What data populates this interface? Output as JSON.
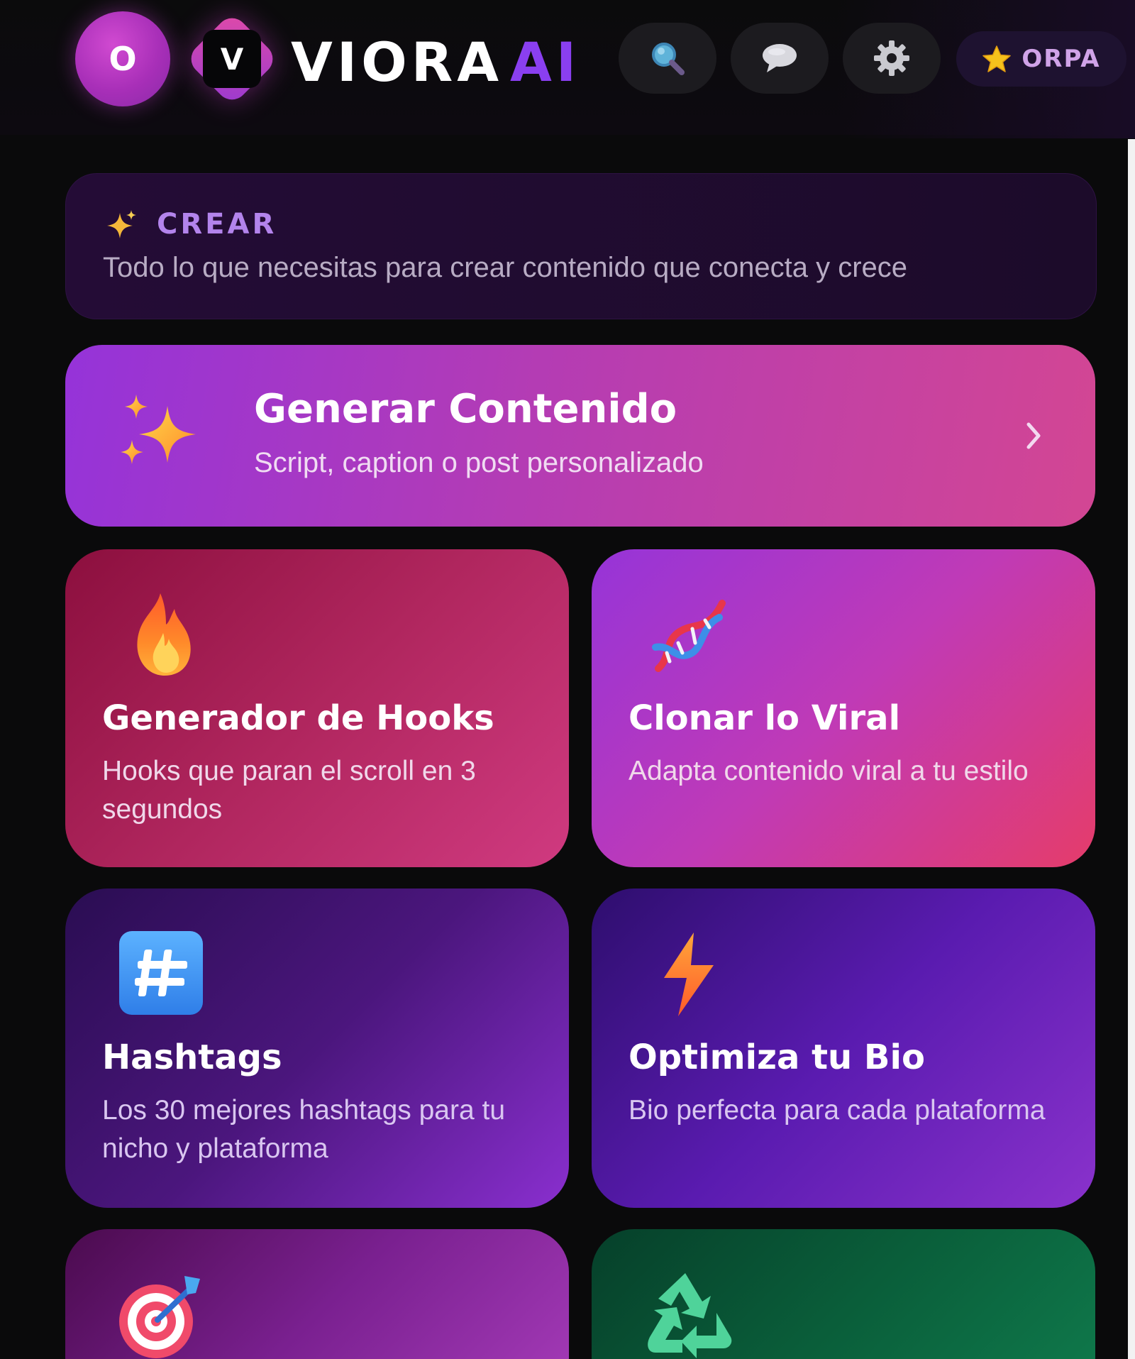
{
  "header": {
    "avatar_initial": "O",
    "logo_letter": "V",
    "brand_primary": "VIORA",
    "brand_accent": "AI",
    "actions": [
      {
        "icon": "search-icon"
      },
      {
        "icon": "chat-bubble-icon"
      },
      {
        "icon": "gear-icon"
      }
    ],
    "pro_badge": {
      "icon": "star-icon",
      "label": "ORPA"
    }
  },
  "section": {
    "icon": "sparkle-icon",
    "title": "CREAR",
    "subtitle": "Todo lo que necesitas para crear contenido que conecta y crece"
  },
  "primary_card": {
    "icon": "sparkles-icon",
    "title": "Generar Contenido",
    "subtitle": "Script, caption o post personalizado"
  },
  "tiles": [
    {
      "icon": "fire-icon",
      "title": "Generador de Hooks",
      "subtitle": "Hooks que paran el scroll en 3 segundos"
    },
    {
      "icon": "dna-icon",
      "title": "Clonar lo Viral",
      "subtitle": "Adapta contenido viral a tu estilo"
    },
    {
      "icon": "hashtag-icon",
      "title": "Hashtags",
      "subtitle": "Los 30 mejores hashtags para tu nicho y plataforma"
    },
    {
      "icon": "lightning-icon",
      "title": "Optimiza tu Bio",
      "subtitle": "Bio perfecta para cada plataforma"
    },
    {
      "icon": "target-icon",
      "title": "",
      "subtitle": ""
    },
    {
      "icon": "recycle-icon",
      "title": "",
      "subtitle": ""
    }
  ],
  "colors": {
    "background": "#0a0a0b",
    "accent_purple": "#8a3ff0",
    "section_title": "#b384ec",
    "pro_label": "#d0a3e8"
  }
}
